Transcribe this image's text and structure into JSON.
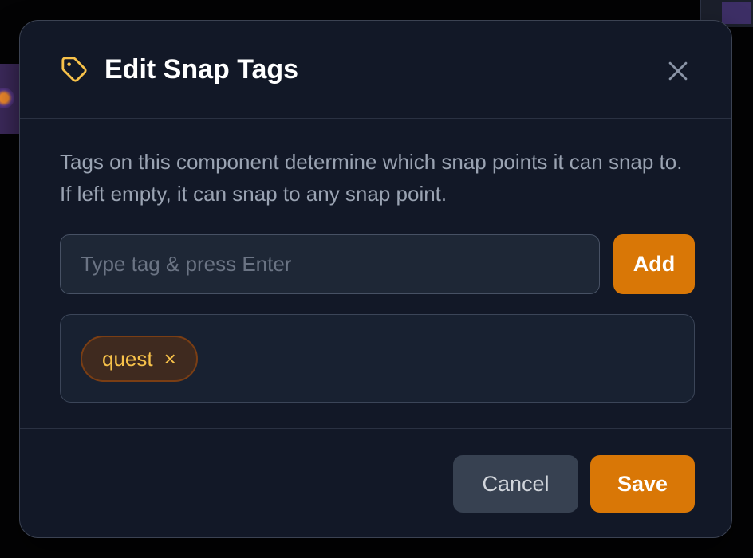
{
  "dialog": {
    "title": "Edit Snap Tags",
    "title_icon": "tag-icon",
    "close_icon": "close-icon",
    "description": "Tags on this component determine which snap points it can snap to. If left empty, it can snap to any snap point."
  },
  "tag_input": {
    "placeholder": "Type tag & press Enter",
    "value": ""
  },
  "add_button": {
    "label": "Add"
  },
  "tags": [
    {
      "label": "quest",
      "remove_symbol": "×"
    }
  ],
  "footer": {
    "cancel_label": "Cancel",
    "save_label": "Save"
  },
  "colors": {
    "accent": "#d97706",
    "icon_accent": "#f8c24a",
    "modal_bg": "#121827",
    "input_bg": "#1e2736",
    "cancel_bg": "#374151"
  }
}
